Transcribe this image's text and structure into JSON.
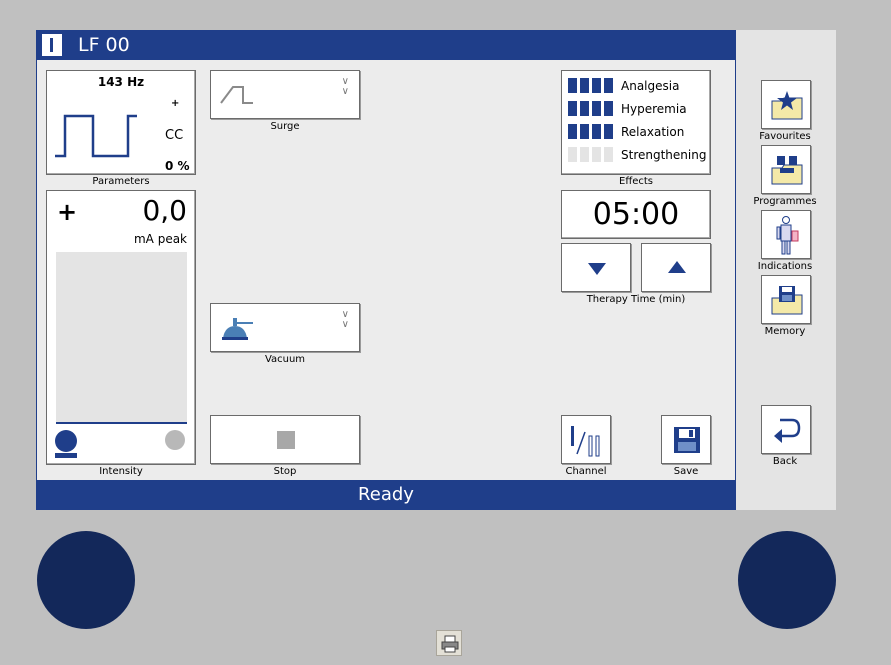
{
  "header": {
    "title": "LF 00"
  },
  "parameters": {
    "frequency": "143 Hz",
    "polarity": "+",
    "mode": "CC",
    "percent": "0 %",
    "caption": "Parameters"
  },
  "intensity": {
    "sign": "+",
    "value": "0,0",
    "unit": "mA peak",
    "caption": "Intensity"
  },
  "surge": {
    "caption": "Surge"
  },
  "vacuum": {
    "caption": "Vacuum"
  },
  "stop": {
    "caption": "Stop"
  },
  "effects": {
    "caption": "Effects",
    "items": [
      {
        "label": "Analgesia",
        "level": 4
      },
      {
        "label": "Hyperemia",
        "level": 4
      },
      {
        "label": "Relaxation",
        "level": 4
      },
      {
        "label": "Strengthening",
        "level": 0
      }
    ]
  },
  "therapy_time": {
    "value": "05:00",
    "caption": "Therapy Time (min)"
  },
  "channel": {
    "caption": "Channel"
  },
  "save": {
    "caption": "Save"
  },
  "status": {
    "text": "Ready"
  },
  "sidebar": {
    "items": [
      {
        "label": "Favourites"
      },
      {
        "label": "Programmes"
      },
      {
        "label": "Indications"
      },
      {
        "label": "Memory"
      }
    ],
    "back_label": "Back"
  },
  "colors": {
    "accent": "#1f3e8a",
    "knob": "#13285a",
    "background": "#c0c0c0"
  }
}
